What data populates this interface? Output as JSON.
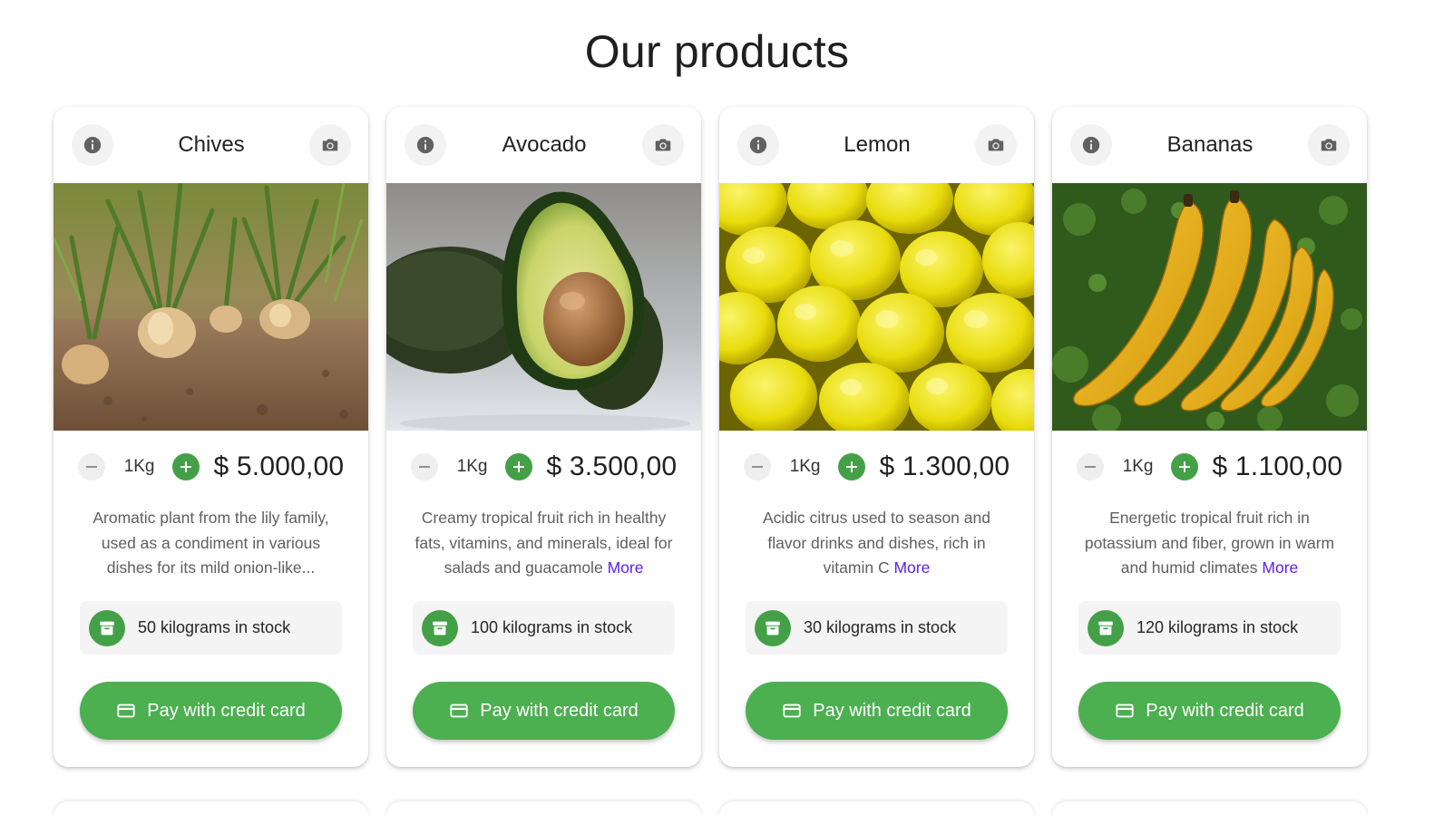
{
  "page": {
    "title": "Our products"
  },
  "theme": {
    "accent": "#4caf50",
    "accent_dark": "#43a047",
    "link": "#5b1ff0"
  },
  "icons": {
    "info": "info-icon",
    "photo": "camera-icon",
    "minus": "minus-icon",
    "plus": "plus-icon",
    "stock": "archive-icon",
    "card": "credit-card-icon"
  },
  "products": [
    {
      "name": "Chives",
      "qty": "1Kg",
      "price": "$ 5.000,00",
      "description": "Aromatic plant from the lily family, used as a condiment in various dishes for its mild onion-like...",
      "more": "",
      "stock": "50 kilograms in stock",
      "pay_label": "Pay with credit card"
    },
    {
      "name": "Avocado",
      "qty": "1Kg",
      "price": "$ 3.500,00",
      "description": "Creamy tropical fruit rich in healthy fats, vitamins, and minerals, ideal for salads and guacamole",
      "more": "More",
      "stock": "100 kilograms in stock",
      "pay_label": "Pay with credit card"
    },
    {
      "name": "Lemon",
      "qty": "1Kg",
      "price": "$ 1.300,00",
      "description": "Acidic citrus used to season and flavor drinks and dishes, rich in vitamin C",
      "more": "More",
      "stock": "30 kilograms in stock",
      "pay_label": "Pay with credit card"
    },
    {
      "name": "Bananas",
      "qty": "1Kg",
      "price": "$ 1.100,00",
      "description": "Energetic tropical fruit rich in potassium and fiber, grown in warm and humid climates",
      "more": "More",
      "stock": "120 kilograms in stock",
      "pay_label": "Pay with credit card"
    }
  ]
}
